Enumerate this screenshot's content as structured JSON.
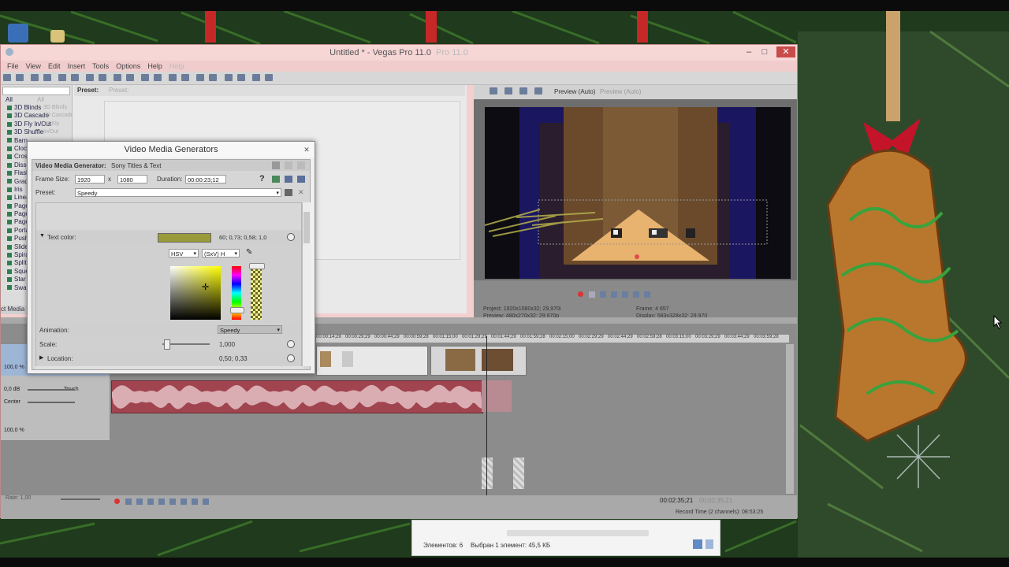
{
  "window": {
    "title": "Untitled * - Vegas Pro 11.0",
    "title_ghost": "Pro 11.0"
  },
  "menu": [
    "File",
    "View",
    "Edit",
    "Insert",
    "Tools",
    "Options",
    "Help",
    "Help"
  ],
  "menu_overlap_text": "File View Edit Insert Tools Options Help",
  "toolbar_labels": {
    "preset": "Preset:",
    "preset_ghost": "Preset:"
  },
  "fx_list": {
    "all": "All",
    "items": [
      "3D Blinds",
      "3D Cascade",
      "3D Fly In/Out",
      "3D Shuffle",
      "Barn",
      "Clock",
      "Cross",
      "Dissolve",
      "Flash",
      "Gradient",
      "Iris",
      "Linear",
      "Page",
      "Page",
      "Page",
      "Portals",
      "Push",
      "Slide",
      "Spiral",
      "Split",
      "Squeeze",
      "Star",
      "Swap"
    ],
    "ghost_items": [
      "3D Blinds",
      "3D Cascade",
      "3D Fly In/Out"
    ]
  },
  "media_tab": "ct Media",
  "preview": {
    "label": "Preview (Auto)",
    "project_label": "Project:",
    "project_value": "1920x1080x32; 29,970i",
    "preview_label": "Preview:",
    "preview_value": "480x270x32; 29,970p",
    "frame_label": "Frame:",
    "frame_value": "4 657",
    "display_label": "Display:",
    "display_value": "583x328x32; 29,970"
  },
  "timeline": {
    "ruler": [
      "00:00:14;29",
      "00:00:29;29",
      "00:00:44;29",
      "00:00:59;28",
      "00:01:15;00",
      "00:01:29;29",
      "00:01:44;29",
      "00:01:59;28",
      "00:02:15;00",
      "00:02:29;29",
      "00:02:44;29",
      "00:02:59;28",
      "00:03:15;00",
      "00:03:29;29",
      "00:03:44;29",
      "00:03:59;28"
    ],
    "level": "100,0 %",
    "level2": "100,0 %",
    "audio_db": "0,0 dB",
    "touch": "Touch",
    "center": "Center",
    "rate": "Rate: 1,00",
    "time_display": "00:02:35;21",
    "time_ghost": "00:02:35;21",
    "record_time": "Record Time (2 channels): 08:53:25"
  },
  "vmg": {
    "title": "Video Media Generators",
    "generator_label": "Video Media Generator:",
    "generator_value": "Sony Titles & Text",
    "frame_size_label": "Frame Size:",
    "width": "1920",
    "x": "x",
    "height": "1080",
    "duration_label": "Duration:",
    "duration": "00:00:23;12",
    "preset_label": "Preset:",
    "preset_value": "Speedy",
    "text_color_label": "Text color:",
    "text_color_value": "60; 0,73; 0,58; 1,0",
    "text_color_hex": "#9b9a3a",
    "mode": "HSV",
    "channel": "(SxV) H",
    "animation_label": "Animation:",
    "animation_value": "Speedy",
    "scale_label": "Scale:",
    "scale_value": "1,000",
    "location_label": "Location:",
    "location_value": "0,50; 0,33",
    "help": "?"
  },
  "explorer": {
    "items_count": "Элементов: 6",
    "selected": "Выбран 1 элемент: 45,5 КБ"
  }
}
